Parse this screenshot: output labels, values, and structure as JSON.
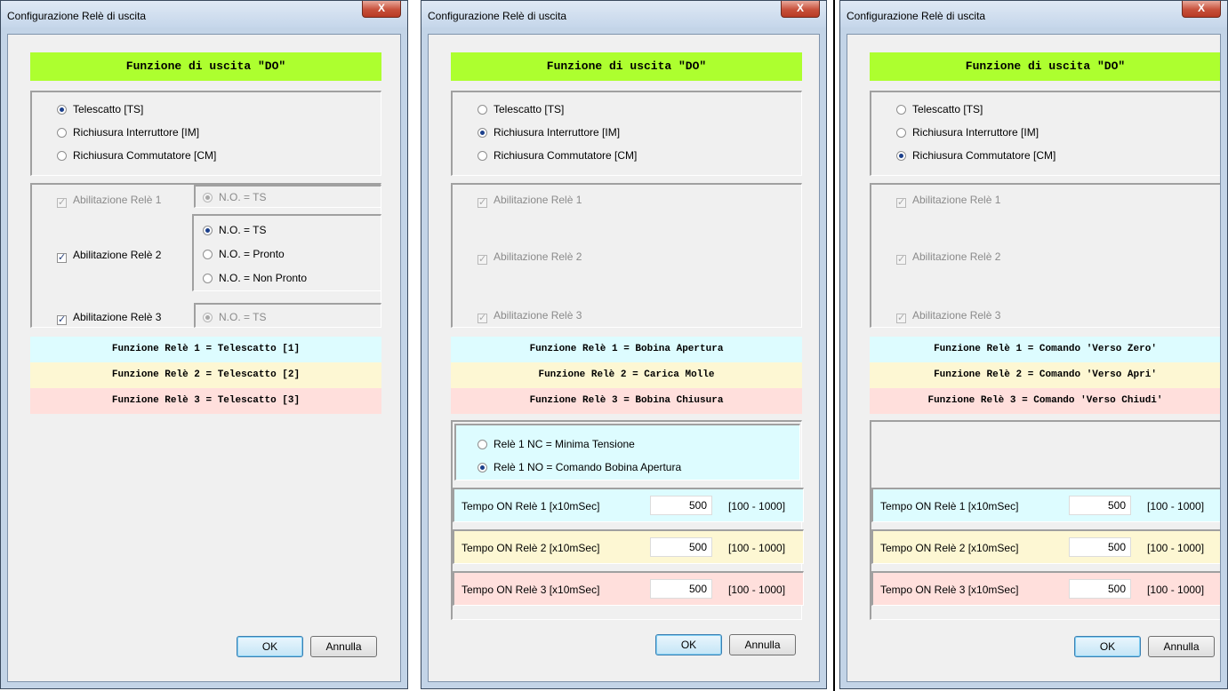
{
  "title": "Configurazione Relè di uscita",
  "close_label": "X",
  "header": "Funzione di uscita \"DO\"",
  "mode_options": [
    "Telescatto [TS]",
    "Richiusura Interruttore [IM]",
    "Richiusura Commutatore [CM]"
  ],
  "relay_enable": [
    "Abilitazione Relè 1",
    "Abilitazione Relè 2",
    "Abilitazione Relè 3"
  ],
  "no_options": {
    "ts": "N.O. = TS",
    "pronto": "N.O. = Pronto",
    "non_pronto": "N.O. = Non Pronto"
  },
  "ok_label": "OK",
  "cancel_label": "Annulla",
  "dialogs": [
    {
      "selected_mode": "Telescatto [TS]",
      "relay_functions": [
        "Funzione Relè 1 = Telescatto [1]",
        "Funzione Relè 2 = Telescatto [2]",
        "Funzione Relè 3 = Telescatto [3]"
      ],
      "relay_enabled": [
        true,
        true,
        true
      ],
      "relay_editable": [
        false,
        true,
        true
      ],
      "relay2_selected": "N.O. = TS"
    },
    {
      "selected_mode": "Richiusura Interruttore [IM]",
      "relay_functions": [
        "Funzione Relè 1 = Bobina Apertura",
        "Funzione Relè 2 = Carica Molle",
        "Funzione Relè 3 = Bobina Chiusura"
      ],
      "relay_enabled": [
        true,
        true,
        true
      ],
      "relay_editable": [
        false,
        false,
        false
      ],
      "relay1_modes": [
        "Relè 1 NC = Minima Tensione",
        "Relè 1 NO = Comando Bobina Apertura"
      ],
      "relay1_selected": "Relè 1 NO = Comando Bobina Apertura",
      "timings": [
        {
          "label": "Tempo ON Relè 1 [x10mSec]",
          "value": "500",
          "range": "[100 - 1000]"
        },
        {
          "label": "Tempo ON Relè 2 [x10mSec]",
          "value": "500",
          "range": "[100 - 1000]"
        },
        {
          "label": "Tempo ON Relè 3 [x10mSec]",
          "value": "500",
          "range": "[100 - 1000]"
        }
      ]
    },
    {
      "selected_mode": "Richiusura Commutatore [CM]",
      "relay_functions": [
        "Funzione Relè 1 = Comando 'Verso Zero'",
        "Funzione Relè 2 = Comando 'Verso Apri'",
        "Funzione Relè 3 = Comando 'Verso Chiudi'"
      ],
      "relay_enabled": [
        true,
        true,
        true
      ],
      "relay_editable": [
        false,
        false,
        false
      ],
      "timings": [
        {
          "label": "Tempo ON Relè 1 [x10mSec]",
          "value": "500",
          "range": "[100 - 1000]"
        },
        {
          "label": "Tempo ON Relè 2 [x10mSec]",
          "value": "500",
          "range": "[100 - 1000]"
        },
        {
          "label": "Tempo ON Relè 3 [x10mSec]",
          "value": "500",
          "range": "[100 - 1000]"
        }
      ]
    }
  ]
}
